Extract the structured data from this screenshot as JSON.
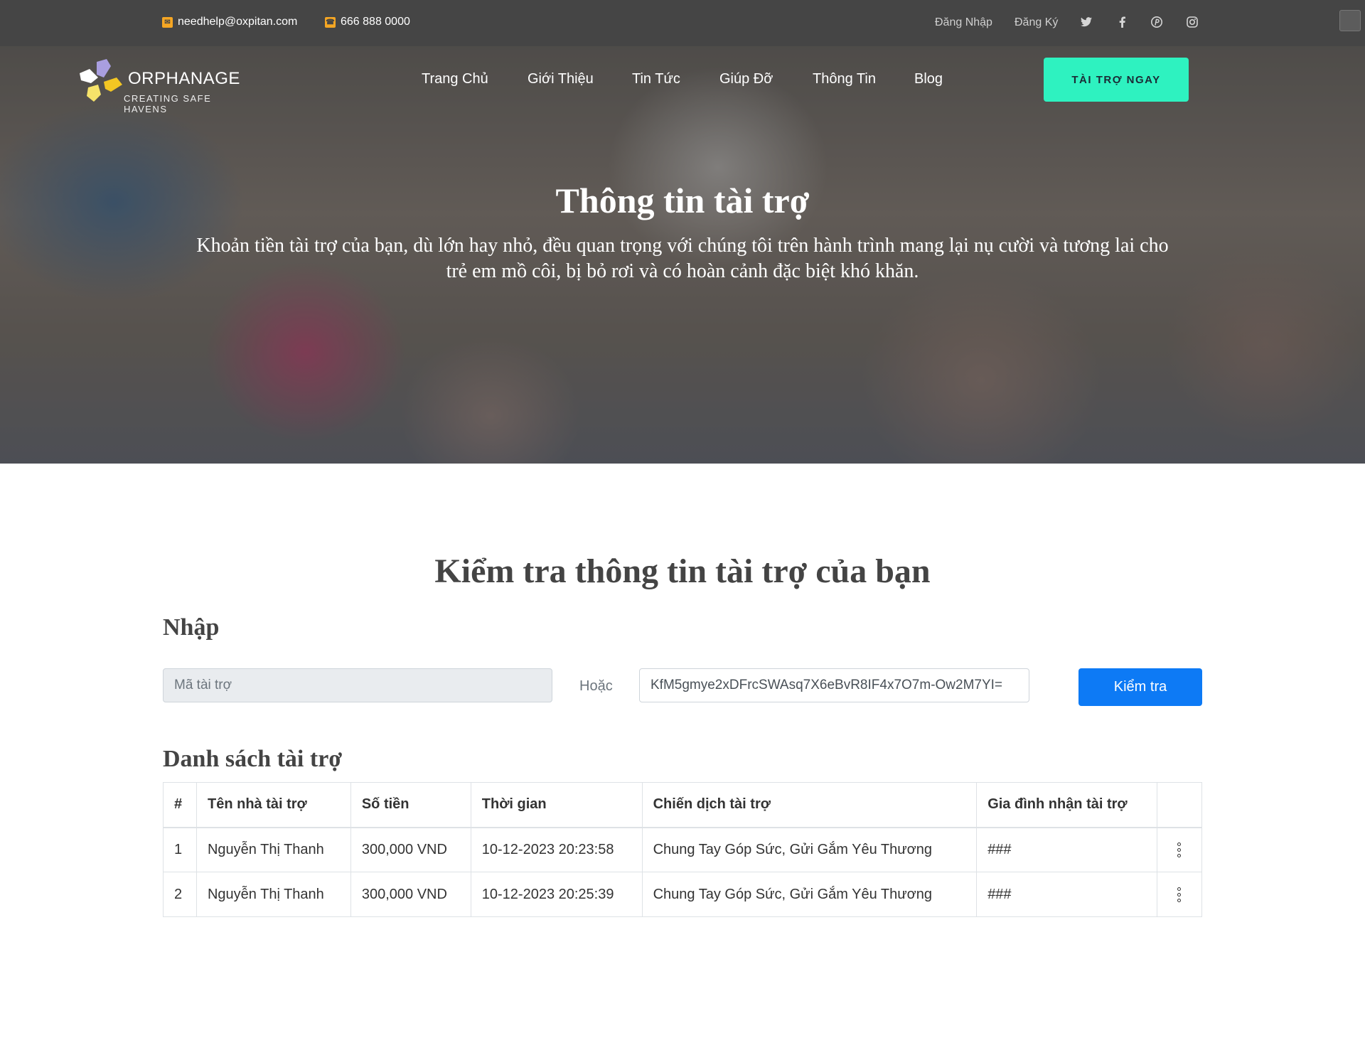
{
  "topbar": {
    "email": "needhelp@oxpitan.com",
    "phone": "666 888 0000",
    "login": "Đăng Nhập",
    "register": "Đăng Ký",
    "social_icons": [
      "twitter-icon",
      "facebook-icon",
      "pinterest-icon",
      "instagram-icon"
    ]
  },
  "header": {
    "brand": "ORPHANAGE",
    "tagline": "CREATING SAFE HAVENS",
    "nav": [
      "Trang Chủ",
      "Giới Thiệu",
      "Tin Tức",
      "Giúp Đỡ",
      "Thông Tin",
      "Blog"
    ],
    "cta": "TÀI TRỢ NGAY",
    "cta_color": "#2ef2c0"
  },
  "hero": {
    "title": "Thông tin tài trợ",
    "subtitle": "Khoản tiền tài trợ của bạn, dù lớn hay nhỏ, đều quan trọng với chúng tôi trên hành trình mang lại nụ cười và tương lai cho trẻ em mồ côi, bị bỏ rơi và có hoàn cảnh đặc biệt khó khăn."
  },
  "lookup": {
    "heading": "Kiểm tra thông tin tài trợ của bạn",
    "input_section": "Nhập",
    "code_placeholder": "Mã tài trợ",
    "or_label": "Hoặc",
    "token_value": "KfM5gmye2xDFrcSWAsq7X6eBvR8IF4x7O7m-Ow2M7YI=",
    "button": "Kiểm tra",
    "button_color": "#0d7af5"
  },
  "donations": {
    "title": "Danh sách tài trợ",
    "columns": [
      "#",
      "Tên nhà tài trợ",
      "Số tiền",
      "Thời gian",
      "Chiến dịch tài trợ",
      "Gia đình nhận tài trợ",
      ""
    ],
    "rows": [
      [
        "1",
        "Nguyễn Thị Thanh",
        "300,000 VND",
        "10-12-2023 20:23:58",
        "Chung Tay Góp Sức, Gửi Gắm Yêu Thương",
        "###"
      ],
      [
        "2",
        "Nguyễn Thị Thanh",
        "300,000 VND",
        "10-12-2023 20:25:39",
        "Chung Tay Góp Sức, Gửi Gắm Yêu Thương",
        "###"
      ]
    ]
  }
}
